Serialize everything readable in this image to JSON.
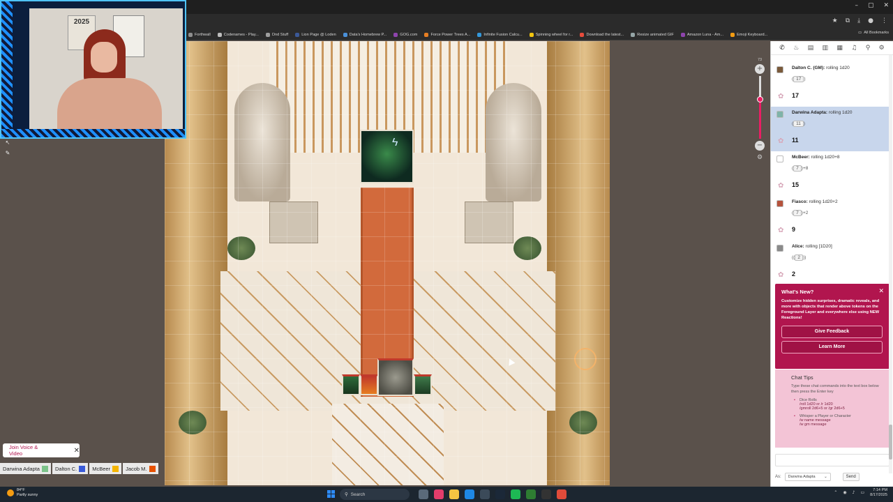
{
  "browser": {
    "window_controls": [
      "–",
      "▢",
      "✕"
    ],
    "bookmarks": [
      {
        "label": "Forthwall",
        "color": "#8e8e8e"
      },
      {
        "label": "Codenames - Play...",
        "color": "#bdbdbd"
      },
      {
        "label": "Dnd Stuff",
        "color": "#9e9e9e"
      },
      {
        "label": "Lion Page @ Loden",
        "color": "#3b5998"
      },
      {
        "label": "Data's Homebrew P...",
        "color": "#4a90d9"
      },
      {
        "label": "GOG.com",
        "color": "#8e44ad"
      },
      {
        "label": "Force Power Trees A...",
        "color": "#e67e22"
      },
      {
        "label": "Infinite Fusion Calcu...",
        "color": "#3498db"
      },
      {
        "label": "Spinning wheel for r...",
        "color": "#f1c40f"
      },
      {
        "label": "Download the latest...",
        "color": "#e74c3c"
      },
      {
        "label": "Resize animated GIF",
        "color": "#95a5a6"
      },
      {
        "label": "Amazon Luna - Am...",
        "color": "#8e44ad"
      },
      {
        "label": "Emoji Keyboard...",
        "color": "#f39c12"
      }
    ],
    "all_bookmarks": "All Bookmarks"
  },
  "webcam": {
    "poster_text": "2025"
  },
  "zoom": {
    "value": "73",
    "level_fraction": 0.62
  },
  "chat": {
    "messages": [
      {
        "who": "Dalton C. (GM):",
        "action": "rolling 1d20",
        "formula_pre": "(",
        "roll": "17",
        "formula_post": ")",
        "result": "17",
        "avatar_color": "#7a5a3a",
        "highlight": false
      },
      {
        "who": "Darwina Adapta:",
        "action": "rolling 1d20",
        "formula_pre": "(",
        "roll": "11",
        "formula_post": ")",
        "result": "11",
        "avatar_color": "#7fb3a9",
        "highlight": true
      },
      {
        "who": "McBeer:",
        "action": "rolling 1d20+8",
        "formula_pre": "(",
        "roll": "7",
        "formula_post": ")+8",
        "result": "15",
        "avatar_color": "#ffffff",
        "highlight": false
      },
      {
        "who": "Fiasco:",
        "action": "rolling 1d20+2",
        "formula_pre": "(",
        "roll": "7",
        "formula_post": ")+2",
        "result": "9",
        "avatar_color": "#b5533c",
        "highlight": false
      },
      {
        "who": "Alice:",
        "action": "rolling [1D20]",
        "formula_pre": "((",
        "roll": "2",
        "formula_post": "))",
        "result": "2",
        "avatar_color": "#8a8a8a",
        "highlight": false
      }
    ],
    "whats_new": {
      "title": "What's New?",
      "body": "Customize hidden surprises, dramatic reveals, and more with objects that render above tokens on the Foreground Layer and everywhere else using NEW Reactions!",
      "feedback_label": "Give Feedback",
      "learn_label": "Learn More"
    },
    "tips": {
      "title": "Chat Tips",
      "body": "Type these chat commands into the text box below then press the Enter key",
      "items": [
        {
          "label": "Dice Rolls",
          "cmd1": "/roll 1d20 or /r 1d20",
          "cmd2": "/gmroll 2d6+5 or /gr 2d6+5"
        },
        {
          "label": "Whisper a Player or Character",
          "cmd1": "/w name message",
          "cmd2": "/w gm message"
        }
      ]
    },
    "as_label": "As:",
    "as_value": "Darwina Adapta",
    "send_label": "Send"
  },
  "voice": {
    "join_label": "Join Voice & Video"
  },
  "players": [
    {
      "name": "Darwina Adapta",
      "color": "#7cc38a"
    },
    {
      "name": "Dalton C.",
      "color": "#3a5bd9"
    },
    {
      "name": "McBeer",
      "color": "#f4b400"
    },
    {
      "name": "Jacob M.",
      "color": "#e65100"
    }
  ],
  "taskbar": {
    "temperature": "84°F",
    "weather": "Partly sunny",
    "search_label": "Search",
    "time": "7:14 PM",
    "date": "8/17/2025"
  },
  "colors": {
    "accent": "#b1154e",
    "highlight_row": "#c8d6ec",
    "zoom_accent": "#e91e63"
  }
}
